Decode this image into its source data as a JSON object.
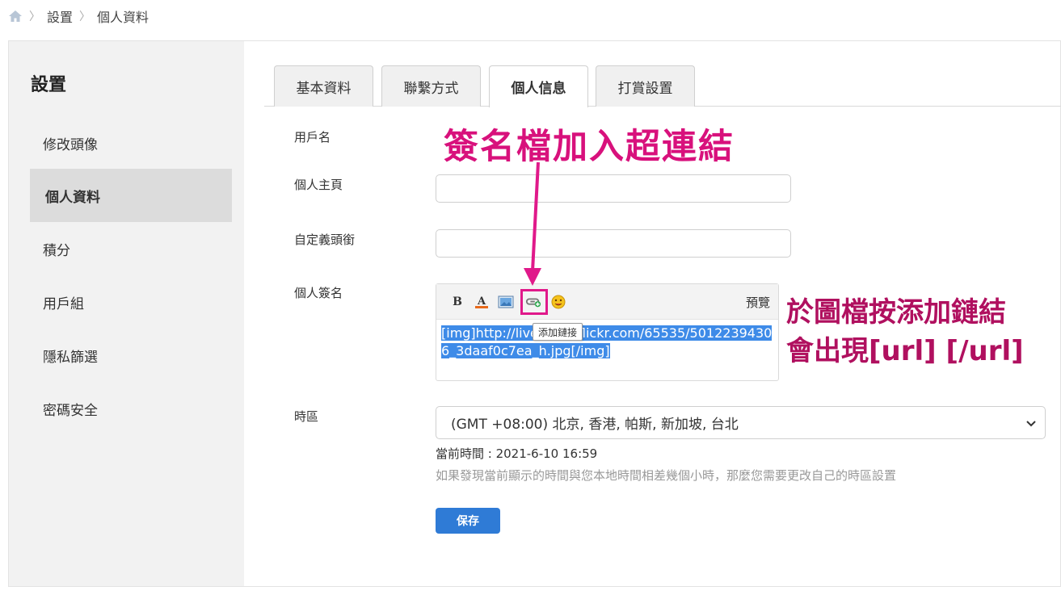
{
  "breadcrumb": {
    "items": [
      "設置",
      "個人資料"
    ]
  },
  "sidebar": {
    "title": "設置",
    "items": [
      {
        "label": "修改頭像"
      },
      {
        "label": "個人資料",
        "active": true
      },
      {
        "label": "積分"
      },
      {
        "label": "用戶組"
      },
      {
        "label": "隱私篩選"
      },
      {
        "label": "密碼安全"
      }
    ]
  },
  "tabs": [
    {
      "label": "基本資料"
    },
    {
      "label": "聯繫方式"
    },
    {
      "label": "個人信息",
      "active": true
    },
    {
      "label": "打賞設置"
    }
  ],
  "form": {
    "username_label": "用戶名",
    "homepage_label": "個人主頁",
    "homepage_value": "",
    "custom_title_label": "自定義頭銜",
    "custom_title_value": "",
    "signature_label": "個人簽名",
    "timezone_label": "時區"
  },
  "editor": {
    "preview_label": "預覽",
    "tooltip": "添加鏈接",
    "content": "[img]http://live.staticflickr.com/65535/50122394306_3daaf0c7ea_h.jpg[/img]"
  },
  "timezone": {
    "selected": "(GMT +08:00) 北京, 香港, 帕斯, 新加坡, 台北",
    "current_time": "當前時間 : 2021-6-10 16:59",
    "hint": "如果發現當前顯示的時間與您本地時間相差幾個小時，那麼您需要更改自己的時區設置"
  },
  "save_label": "保存",
  "annotations": {
    "title": "簽名檔加入超連結",
    "note_line1": "於圖檔按添加鏈結",
    "note_line2": "會出現[url]  [/url]"
  },
  "colors": {
    "accent": "#2f7bd6",
    "annotation": "#d8117c",
    "selection": "#3e8be8"
  }
}
